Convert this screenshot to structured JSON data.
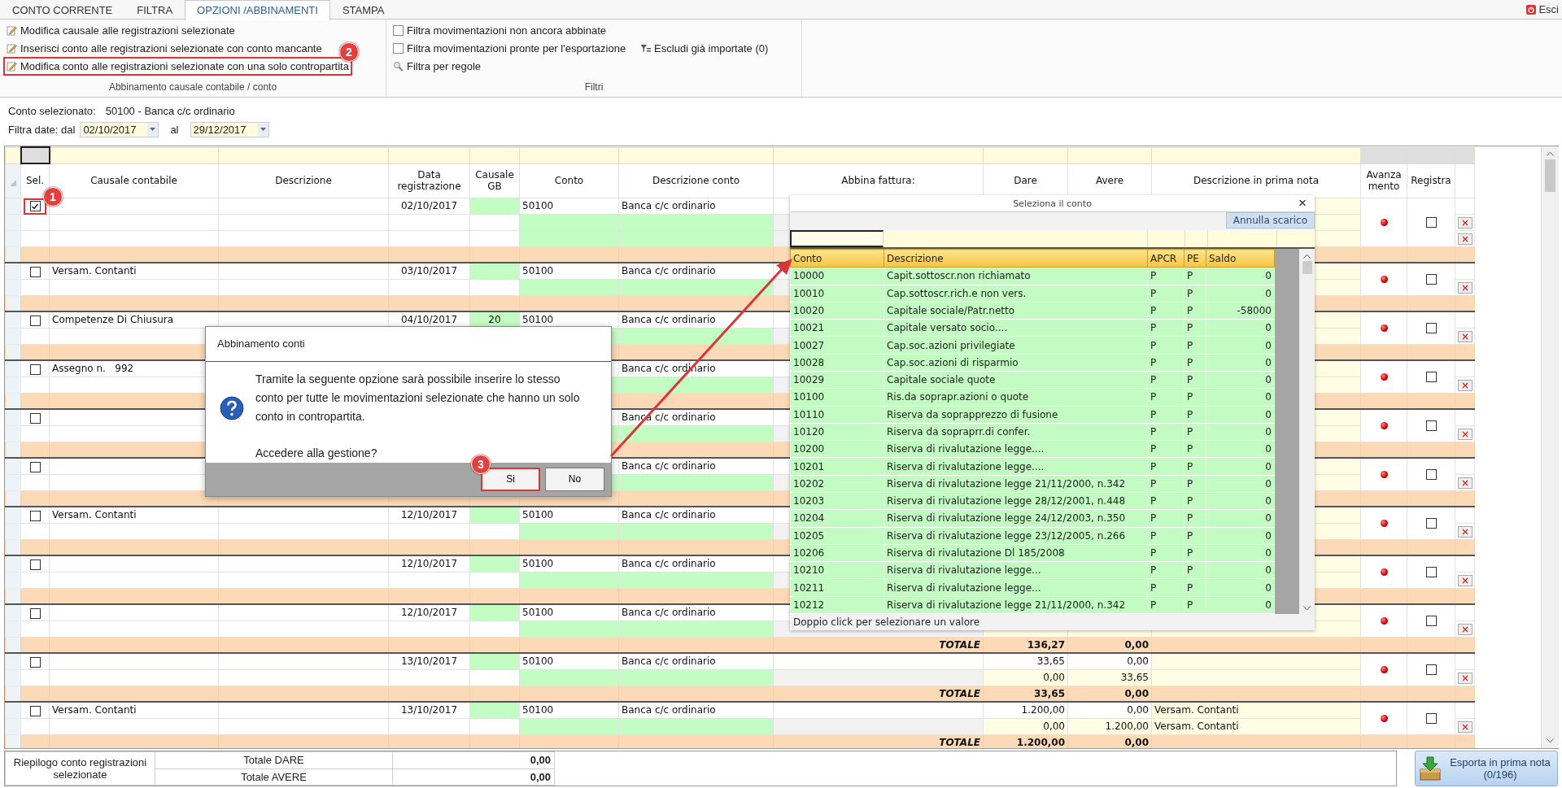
{
  "tabs": [
    {
      "label": "CONTO CORRENTE",
      "selected": false
    },
    {
      "label": "FILTRA",
      "selected": false
    },
    {
      "label": "OPZIONI /ABBINAMENTI",
      "selected": true
    },
    {
      "label": "STAMPA",
      "selected": false
    }
  ],
  "exit_button": {
    "label": "Esci"
  },
  "ribbon": {
    "groups": [
      {
        "title": "Abbinamento causale contabile / conto",
        "items": [
          {
            "kind": "action",
            "label": "Modifica causale alle registrazioni selezionate"
          },
          {
            "kind": "action",
            "label": "Inserisci conto alle registrazioni selezionate con conto mancante"
          },
          {
            "kind": "action",
            "label": "Modifica conto alle registrazioni selezionate con una solo contropartita",
            "marker": "2"
          }
        ]
      },
      {
        "title": "Filtri",
        "items": [
          {
            "kind": "checkbox",
            "label": "Filtra movimentazioni non ancora abbinate",
            "checked": false
          },
          {
            "kind": "checkbox",
            "label": "Filtra movimentazioni pronte per l'esportazione",
            "checked": false,
            "side_action": "Escludi già importate (0)"
          },
          {
            "kind": "search",
            "label": "Filtra per regole"
          }
        ]
      }
    ]
  },
  "account": {
    "label": "Conto selezionato:",
    "value": "50100 - Banca c/c ordinario"
  },
  "date_filter": {
    "label": "Filtra date: dal",
    "from": "02/10/2017",
    "to_label": "al",
    "to": "29/12/2017"
  },
  "table": {
    "columns": [
      "Sel.",
      "Causale contabile",
      "Descrizione",
      "Data registrazione",
      "Causale GB",
      "Conto",
      "Descrizione conto",
      "Abbina fattura:",
      "Dare",
      "Avere",
      "Descrizione in prima nota",
      "Avanza mento",
      "Registra"
    ],
    "groups": [
      {
        "kind": "three_line",
        "selected": true,
        "marker": "1",
        "date": "02/10/2017",
        "conto": "50100",
        "descrizione_conto": "Banca c/c ordinario",
        "registra": false
      },
      {
        "kind": "two_line",
        "selected": false,
        "causale": "Versam. Contanti",
        "date": "03/10/2017",
        "conto": "50100",
        "descrizione_conto": "Banca c/c ordinario",
        "registra": false
      },
      {
        "kind": "two_line",
        "selected": false,
        "causale": "Competenze Di Chiusura",
        "date": "04/10/2017",
        "causale_gb": "20",
        "conto": "50100",
        "descrizione_conto": "Banca c/c ordinario",
        "registra": false
      },
      {
        "kind": "two_line",
        "selected": false,
        "causale": "Assegno n.   992",
        "descrizione_conto": "Banca c/c ordinario",
        "registra": false
      },
      {
        "kind": "two_line",
        "selected": false,
        "descrizione_conto": "Banca c/c ordinario",
        "registra": false
      },
      {
        "kind": "two_line",
        "selected": false,
        "descrizione_conto": "Banca c/c ordinario",
        "registra": false
      },
      {
        "kind": "two_line",
        "selected": false,
        "causale": "Versam. Contanti",
        "date": "12/10/2017",
        "conto": "50100",
        "descrizione_conto": "Banca c/c ordinario",
        "registra": false
      },
      {
        "kind": "two_line",
        "selected": false,
        "date": "12/10/2017",
        "conto": "50100",
        "descrizione_conto": "Banca c/c ordinario",
        "registra": false
      },
      {
        "kind": "two_line",
        "selected": false,
        "date": "12/10/2017",
        "conto": "50100",
        "descrizione_conto": "Banca c/c ordinario",
        "registra": false,
        "total": {
          "label": "TOTALE",
          "dare": "136,27",
          "avere": "0,00"
        }
      },
      {
        "kind": "two_line",
        "selected": false,
        "date": "13/10/2017",
        "conto": "50100",
        "descrizione_conto": "Banca c/c ordinario",
        "registra": false,
        "lines": [
          {
            "dare": "33,65",
            "avere": "0,00"
          },
          {
            "dare": "0,00",
            "avere": "33,65"
          }
        ],
        "total": {
          "label": "TOTALE",
          "dare": "33,65",
          "avere": "0,00"
        }
      },
      {
        "kind": "two_line",
        "selected": false,
        "causale": "Versam. Contanti",
        "date": "13/10/2017",
        "conto": "50100",
        "descrizione_conto": "Banca c/c ordinario",
        "registra": false,
        "lines": [
          {
            "dare": "1.200,00",
            "avere": "0,00",
            "descrizione": "Versam. Contanti"
          },
          {
            "dare": "0,00",
            "avere": "1.200,00",
            "descrizione": "Versam. Contanti"
          }
        ],
        "total": {
          "label": "TOTALE",
          "dare": "1.200,00",
          "avere": "0,00"
        }
      }
    ]
  },
  "summary": {
    "label": "Riepilogo conto registrazioni selezionate",
    "rows": [
      {
        "label": "Totale DARE",
        "value": "0,00"
      },
      {
        "label": "Totale AVERE",
        "value": "0,00"
      }
    ]
  },
  "export_button": {
    "label": "Esporta in prima nota",
    "count": "(0/196)"
  },
  "dialog": {
    "title": "Abbinamento conti",
    "message": "Tramite la seguente opzione sarà possibile inserire lo stesso conto per tutte le movimentazioni selezionate che hanno un solo conto in contropartita.",
    "question": "Accedere alla gestione?",
    "buttons": [
      {
        "label": "Si",
        "marker": "3"
      },
      {
        "label": "No"
      }
    ]
  },
  "account_picker": {
    "title": "Seleziona il conto",
    "close": "×",
    "cancel_button": "Annulla scarico",
    "columns": [
      "Conto",
      "Descrizione",
      "APCR",
      "PE",
      "Saldo"
    ],
    "rows": [
      {
        "conto": "10000",
        "descrizione": "Capit.sottoscr.non richiamato",
        "apcr": "P",
        "pe": "P",
        "saldo": "0"
      },
      {
        "conto": "10010",
        "descrizione": "Cap.sottoscr.rich.e non vers.",
        "apcr": "P",
        "pe": "P",
        "saldo": "0"
      },
      {
        "conto": "10020",
        "descrizione": "Capitale sociale/Patr.netto",
        "apcr": "P",
        "pe": "P",
        "saldo": "-58000"
      },
      {
        "conto": "10021",
        "descrizione": "Capitale versato socio....",
        "apcr": "P",
        "pe": "P",
        "saldo": "0"
      },
      {
        "conto": "10027",
        "descrizione": "Cap.soc.azioni privilegiate",
        "apcr": "P",
        "pe": "P",
        "saldo": "0"
      },
      {
        "conto": "10028",
        "descrizione": "Cap.soc.azioni di risparmio",
        "apcr": "P",
        "pe": "P",
        "saldo": "0"
      },
      {
        "conto": "10029",
        "descrizione": "Capitale sociale quote",
        "apcr": "P",
        "pe": "P",
        "saldo": "0"
      },
      {
        "conto": "10100",
        "descrizione": "Ris.da soprapr.azioni o quote",
        "apcr": "P",
        "pe": "P",
        "saldo": "0"
      },
      {
        "conto": "10110",
        "descrizione": "Riserva da soprapprezzo di fusione",
        "apcr": "P",
        "pe": "P",
        "saldo": "0"
      },
      {
        "conto": "10120",
        "descrizione": "Riserva da sopraprr.di confer.",
        "apcr": "P",
        "pe": "P",
        "saldo": "0"
      },
      {
        "conto": "10200",
        "descrizione": "Riserva di rivalutazione legge....",
        "apcr": "P",
        "pe": "P",
        "saldo": "0"
      },
      {
        "conto": "10201",
        "descrizione": "Riserva di rivalutazione legge....",
        "apcr": "P",
        "pe": "P",
        "saldo": "0"
      },
      {
        "conto": "10202",
        "descrizione": "Riserva di rivalutazione legge 21/11/2000, n.342",
        "apcr": "P",
        "pe": "P",
        "saldo": "0"
      },
      {
        "conto": "10203",
        "descrizione": "Riserva di rivalutazione legge 28/12/2001, n.448",
        "apcr": "P",
        "pe": "P",
        "saldo": "0"
      },
      {
        "conto": "10204",
        "descrizione": "Riserva di rivalutazione legge 24/12/2003, n.350",
        "apcr": "P",
        "pe": "P",
        "saldo": "0"
      },
      {
        "conto": "10205",
        "descrizione": "Riserva di rivalutazione legge 23/12/2005, n.266",
        "apcr": "P",
        "pe": "P",
        "saldo": "0"
      },
      {
        "conto": "10206",
        "descrizione": "Riserva di rivalutazione Dl 185/2008",
        "apcr": "P",
        "pe": "P",
        "saldo": "0"
      },
      {
        "conto": "10210",
        "descrizione": "Riserva di rivalutazione legge...",
        "apcr": "P",
        "pe": "P",
        "saldo": "0"
      },
      {
        "conto": "10211",
        "descrizione": "Riserva di rivalutazione legge...",
        "apcr": "P",
        "pe": "P",
        "saldo": "0"
      },
      {
        "conto": "10212",
        "descrizione": "Riserva di rivalutazione legge 21/11/2000, n.342",
        "apcr": "P",
        "pe": "P",
        "saldo": "0"
      }
    ],
    "footer": "Doppio click per selezionare un valore"
  }
}
